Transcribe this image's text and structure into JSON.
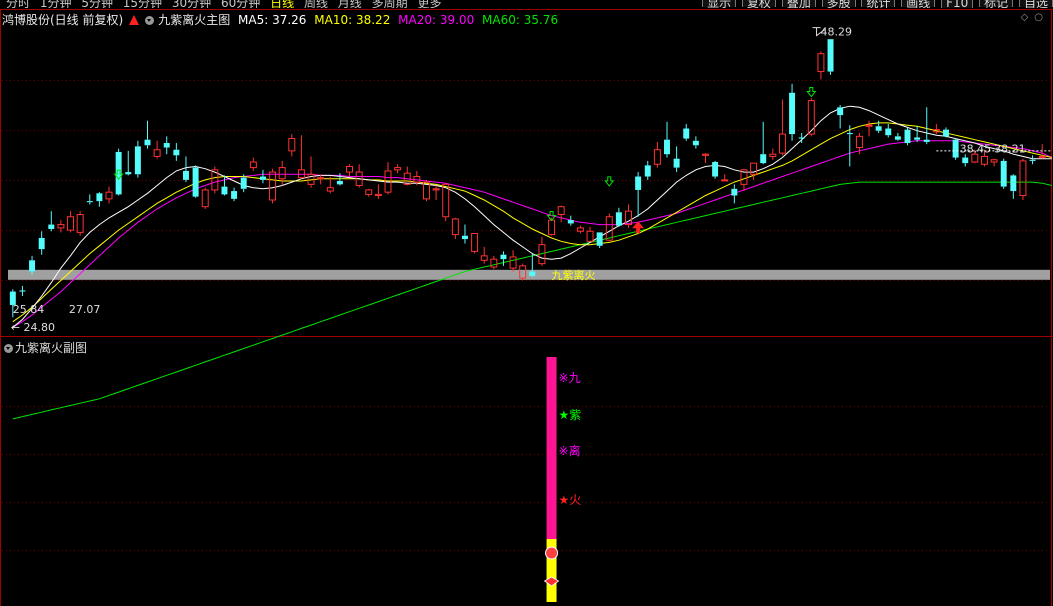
{
  "toolbar": {
    "periods": [
      "分时",
      "1分钟",
      "5分钟",
      "15分钟",
      "30分钟",
      "60分钟",
      "日线",
      "周线",
      "月线",
      "多周期",
      "更多"
    ],
    "active_period": "日线",
    "tools": [
      "显示",
      "复权",
      "叠加",
      "多股",
      "统计",
      "画线",
      "F10",
      "标记",
      "自选"
    ]
  },
  "main_legend": {
    "stock": "鸿博股份(日线 前复权)",
    "indicator": "九紫离火主图",
    "ma5": "MA5: 37.26",
    "ma10": "MA10: 38.22",
    "ma20": "MA20: 39.00",
    "ma60": "MA60: 35.76"
  },
  "sub_legend": {
    "name": "九紫离火副图"
  },
  "colors": {
    "up": "#ff3232",
    "down": "#54fcfc",
    "ma5": "#ffffff",
    "ma10": "#ffff00",
    "ma20": "#ff00ff",
    "ma60": "#00e600",
    "band": "#a0a0a0",
    "sub_bar": "#ff1493",
    "sub_bar_lower": "#ffff00"
  },
  "chart_data": [
    {
      "type": "candlestick",
      "title": "鸿博股份(日线 前复权)",
      "ylim": [
        23.2,
        50.6
      ],
      "candles": [
        [
          27.0,
          25.8,
          27.2,
          24.7
        ],
        [
          27.1,
          27.0,
          27.5,
          26.6
        ],
        [
          29.8,
          28.8,
          30.2,
          28.5
        ],
        [
          31.8,
          30.8,
          32.4,
          30.3
        ],
        [
          33.0,
          32.6,
          34.2,
          32.4
        ],
        [
          32.7,
          33.0,
          33.4,
          32.3
        ],
        [
          32.5,
          33.7,
          34.2,
          32.3
        ],
        [
          32.3,
          33.9,
          34.2,
          32.0
        ],
        [
          35.1,
          35.0,
          35.7,
          34.8
        ],
        [
          35.8,
          35.1,
          35.9,
          34.6
        ],
        [
          35.3,
          35.9,
          36.4,
          34.9
        ],
        [
          39.5,
          35.7,
          39.8,
          35.6
        ],
        [
          37.7,
          37.5,
          39.6,
          37.4
        ],
        [
          40.0,
          37.5,
          40.5,
          37.2
        ],
        [
          40.6,
          40.1,
          42.3,
          39.8
        ],
        [
          39.1,
          39.7,
          40.5,
          38.9
        ],
        [
          40.3,
          39.9,
          40.9,
          39.3
        ],
        [
          39.7,
          39.2,
          40.3,
          38.7
        ],
        [
          37.8,
          37.0,
          39.1,
          36.8
        ],
        [
          38.1,
          35.5,
          38.3,
          35.4
        ],
        [
          34.6,
          36.1,
          36.3,
          34.4
        ],
        [
          36.1,
          37.9,
          38.2,
          35.8
        ],
        [
          36.4,
          35.7,
          37.4,
          35.6
        ],
        [
          36.0,
          35.3,
          36.3,
          35.1
        ],
        [
          37.2,
          36.2,
          37.5,
          35.9
        ],
        [
          38.1,
          38.6,
          39.0,
          37.8
        ],
        [
          37.3,
          37.0,
          37.9,
          36.7
        ],
        [
          35.2,
          37.7,
          38.0,
          34.9
        ],
        [
          37.1,
          38.1,
          38.7,
          36.5
        ],
        [
          39.6,
          40.7,
          41.1,
          39.1
        ],
        [
          37.2,
          37.9,
          41.0,
          37.1
        ],
        [
          36.6,
          37.5,
          39.1,
          36.3
        ],
        [
          37.1,
          37.2,
          37.5,
          36.6
        ],
        [
          36.0,
          36.3,
          37.3,
          35.8
        ],
        [
          36.9,
          36.6,
          37.6,
          36.5
        ],
        [
          37.7,
          38.2,
          38.4,
          37.3
        ],
        [
          36.5,
          37.7,
          38.4,
          36.3
        ],
        [
          35.7,
          36.1,
          36.2,
          35.5
        ],
        [
          35.6,
          35.7,
          36.6,
          35.3
        ],
        [
          35.9,
          37.8,
          38.6,
          35.7
        ],
        [
          37.9,
          38.1,
          38.4,
          37.6
        ],
        [
          36.6,
          37.6,
          38.2,
          36.5
        ],
        [
          36.8,
          37.3,
          37.8,
          36.5
        ],
        [
          35.3,
          36.8,
          37.0,
          35.1
        ],
        [
          36.1,
          36.2,
          36.5,
          35.2
        ],
        [
          33.7,
          36.6,
          36.7,
          33.3
        ],
        [
          32.1,
          33.5,
          33.6,
          31.7
        ],
        [
          32.0,
          31.7,
          33.0,
          31.3
        ],
        [
          30.6,
          32.2,
          32.2,
          30.4
        ],
        [
          29.8,
          30.2,
          31.0,
          29.5
        ],
        [
          29.2,
          29.9,
          30.2,
          29.0
        ],
        [
          30.3,
          29.9,
          30.6,
          29.3
        ],
        [
          29.1,
          30.1,
          30.7,
          28.8
        ],
        [
          28.2,
          29.3,
          29.5,
          28.0
        ],
        [
          28.8,
          28.4,
          30.4,
          28.3
        ],
        [
          29.5,
          31.2,
          31.9,
          29.3
        ],
        [
          32.1,
          33.4,
          33.6,
          32.0
        ],
        [
          33.9,
          34.6,
          34.7,
          33.2
        ],
        [
          33.4,
          33.1,
          33.8,
          32.9
        ],
        [
          32.4,
          32.7,
          32.9,
          32.2
        ],
        [
          31.5,
          32.4,
          32.8,
          31.5
        ],
        [
          32.3,
          31.1,
          32.3,
          30.9
        ],
        [
          31.6,
          33.7,
          34.0,
          31.5
        ],
        [
          34.1,
          32.9,
          34.5,
          32.8
        ],
        [
          33.0,
          34.2,
          34.8,
          32.7
        ],
        [
          37.3,
          36.1,
          37.7,
          33.7
        ],
        [
          38.3,
          37.3,
          38.7,
          37.0
        ],
        [
          38.4,
          39.7,
          40.4,
          38.1
        ],
        [
          40.6,
          39.3,
          42.2,
          39.0
        ],
        [
          38.9,
          38.1,
          40.0,
          37.7
        ],
        [
          41.6,
          40.7,
          42.0,
          40.5
        ],
        [
          40.5,
          40.1,
          40.9,
          39.8
        ],
        [
          39.2,
          39.3,
          39.4,
          38.5
        ],
        [
          38.6,
          37.3,
          38.7,
          37.1
        ],
        [
          37.0,
          37.0,
          37.5,
          37.0
        ],
        [
          36.2,
          35.6,
          36.6,
          34.9
        ],
        [
          36.6,
          37.9,
          38.0,
          36.0
        ],
        [
          37.5,
          38.5,
          38.5,
          37.0
        ],
        [
          39.3,
          38.5,
          42.2,
          38.4
        ],
        [
          39.1,
          39.3,
          39.8,
          38.8
        ],
        [
          39.4,
          41.1,
          44.2,
          39.2
        ],
        [
          44.8,
          41.1,
          45.6,
          40.5
        ],
        [
          40.8,
          40.7,
          41.2,
          40.3
        ],
        [
          41.1,
          44.1,
          44.3,
          40.9
        ],
        [
          46.7,
          48.3,
          48.5,
          46.0
        ],
        [
          49.6,
          46.7,
          49.6,
          46.4
        ],
        [
          43.5,
          42.8,
          43.7,
          41.6
        ],
        [
          41.2,
          41.1,
          41.9,
          38.2
        ],
        [
          39.9,
          40.9,
          41.2,
          39.3
        ],
        [
          41.8,
          41.9,
          42.3,
          40.9
        ],
        [
          41.8,
          41.4,
          42.3,
          41.2
        ],
        [
          41.6,
          41.0,
          42.0,
          40.8
        ],
        [
          40.9,
          40.6,
          41.2,
          40.5
        ],
        [
          41.5,
          40.3,
          41.7,
          40.1
        ],
        [
          40.8,
          40.6,
          41.8,
          40.4
        ],
        [
          40.6,
          40.4,
          43.5,
          40.2
        ],
        [
          41.3,
          41.5,
          42.0,
          41.1
        ],
        [
          41.5,
          40.9,
          41.7,
          40.8
        ],
        [
          40.6,
          39.0,
          40.7,
          38.8
        ],
        [
          39.0,
          38.5,
          39.3,
          38.2
        ],
        [
          38.6,
          39.3,
          39.7,
          38.5
        ],
        [
          38.4,
          39.1,
          39.7,
          38.2
        ],
        [
          38.6,
          38.8,
          38.9,
          38.2
        ],
        [
          38.7,
          36.4,
          38.9,
          36.2
        ],
        [
          37.4,
          36.0,
          37.5,
          35.3
        ],
        [
          35.6,
          38.7,
          38.9,
          35.2
        ],
        [
          38.8,
          38.7,
          39.2,
          38.4
        ],
        [
          39.1,
          39.1,
          40.2,
          38.9
        ]
      ],
      "series": [
        {
          "name": "MA5",
          "values": [
            23.8,
            24.5,
            25.5,
            26.6,
            27.8,
            29.1,
            30.2,
            31.4,
            32.3,
            33.0,
            33.6,
            34.1,
            34.6,
            35.2,
            35.8,
            36.5,
            37.2,
            37.8,
            38.1,
            38.2,
            38.0,
            37.7,
            37.3,
            36.9,
            36.5,
            36.3,
            36.2,
            36.3,
            36.5,
            36.8,
            37.1,
            37.3,
            37.4,
            37.4,
            37.3,
            37.2,
            37.1,
            37.0,
            36.9,
            36.8,
            36.8,
            36.7,
            36.7,
            36.6,
            36.5,
            36.3,
            35.9,
            35.3,
            34.6,
            33.8,
            33.0,
            32.3,
            31.6,
            31.0,
            30.4,
            30.0,
            29.9,
            30.0,
            30.4,
            30.9,
            31.4,
            31.9,
            32.4,
            32.9,
            33.3,
            33.8,
            34.4,
            35.2,
            36.0,
            36.8,
            37.4,
            37.9,
            38.2,
            38.3,
            38.2,
            37.9,
            37.7,
            37.7,
            38.0,
            38.4,
            39.0,
            39.8,
            40.6,
            41.4,
            42.3,
            43.0,
            43.4,
            43.6,
            43.5,
            43.2,
            42.8,
            42.4,
            42.0,
            41.7,
            41.4,
            41.2,
            41.0,
            40.9,
            40.7,
            40.5,
            40.3,
            40.0,
            39.8,
            39.6,
            39.3,
            39.1,
            38.9,
            38.9,
            38.9
          ]
        },
        {
          "name": "MA10",
          "values": [
            24.3,
            24.9,
            25.6,
            26.4,
            27.2,
            28.0,
            28.8,
            29.6,
            30.4,
            31.1,
            31.8,
            32.5,
            33.1,
            33.7,
            34.3,
            34.9,
            35.4,
            35.9,
            36.3,
            36.7,
            37.0,
            37.2,
            37.3,
            37.3,
            37.3,
            37.2,
            37.1,
            37.0,
            36.9,
            36.9,
            36.9,
            37.0,
            37.1,
            37.1,
            37.1,
            37.1,
            37.1,
            37.0,
            37.0,
            36.9,
            36.9,
            36.9,
            36.8,
            36.7,
            36.6,
            36.4,
            36.2,
            36.0,
            35.6,
            35.2,
            34.7,
            34.2,
            33.6,
            33.1,
            32.6,
            32.2,
            31.8,
            31.5,
            31.3,
            31.2,
            31.2,
            31.3,
            31.4,
            31.6,
            31.9,
            32.2,
            32.6,
            33.1,
            33.6,
            34.1,
            34.6,
            35.1,
            35.6,
            36.0,
            36.4,
            36.8,
            37.1,
            37.4,
            37.7,
            38.0,
            38.3,
            38.7,
            39.2,
            39.7,
            40.2,
            40.7,
            41.1,
            41.5,
            41.8,
            42.0,
            42.1,
            42.1,
            42.0,
            41.9,
            41.8,
            41.6,
            41.4,
            41.2,
            41.0,
            40.8,
            40.6,
            40.4,
            40.2,
            40.0,
            39.8,
            39.6,
            39.4,
            39.2,
            39.0
          ]
        },
        {
          "name": "MA20",
          "values": [
            23.8,
            24.3,
            24.9,
            25.6,
            26.3,
            27.0,
            27.8,
            28.6,
            29.4,
            30.2,
            31.0,
            31.8,
            32.5,
            33.2,
            33.8,
            34.4,
            34.9,
            35.4,
            35.8,
            36.2,
            36.5,
            36.8,
            37.0,
            37.2,
            37.3,
            37.4,
            37.5,
            37.5,
            37.5,
            37.5,
            37.5,
            37.5,
            37.4,
            37.4,
            37.4,
            37.3,
            37.3,
            37.3,
            37.3,
            37.2,
            37.2,
            37.1,
            37.0,
            36.9,
            36.8,
            36.7,
            36.5,
            36.3,
            36.1,
            35.9,
            35.6,
            35.3,
            35.0,
            34.7,
            34.4,
            34.1,
            33.8,
            33.6,
            33.4,
            33.2,
            33.1,
            33.0,
            33.0,
            33.0,
            33.1,
            33.2,
            33.4,
            33.6,
            33.8,
            34.0,
            34.3,
            34.6,
            34.9,
            35.2,
            35.5,
            35.8,
            36.1,
            36.4,
            36.7,
            37.0,
            37.3,
            37.6,
            37.9,
            38.2,
            38.5,
            38.8,
            39.1,
            39.4,
            39.6,
            39.8,
            40.0,
            40.2,
            40.3,
            40.4,
            40.5,
            40.5,
            40.5,
            40.5,
            40.5,
            40.4,
            40.3,
            40.2,
            40.1,
            40.0,
            39.9,
            39.8,
            39.6,
            39.4,
            39.0
          ]
        },
        {
          "name": "MA60",
          "values": [
            15.6,
            15.8,
            16.0,
            16.2,
            16.4,
            16.6,
            16.8,
            17.0,
            17.2,
            17.4,
            17.7,
            18.0,
            18.3,
            18.6,
            18.9,
            19.2,
            19.5,
            19.8,
            20.1,
            20.4,
            20.7,
            21.0,
            21.3,
            21.6,
            21.9,
            22.2,
            22.5,
            22.8,
            23.1,
            23.4,
            23.7,
            24.0,
            24.3,
            24.6,
            24.9,
            25.2,
            25.5,
            25.8,
            26.1,
            26.4,
            26.7,
            27.0,
            27.3,
            27.6,
            27.9,
            28.2,
            28.5,
            28.8,
            29.0,
            29.2,
            29.4,
            29.6,
            29.8,
            30.0,
            30.2,
            30.4,
            30.6,
            30.8,
            31.0,
            31.2,
            31.4,
            31.6,
            31.8,
            32.0,
            32.2,
            32.4,
            32.6,
            32.8,
            33.0,
            33.2,
            33.4,
            33.6,
            33.8,
            34.0,
            34.2,
            34.4,
            34.6,
            34.8,
            35.0,
            35.2,
            35.4,
            35.6,
            35.8,
            36.0,
            36.2,
            36.4,
            36.6,
            36.7,
            36.8,
            36.8,
            36.8,
            36.8,
            36.8,
            36.8,
            36.8,
            36.8,
            36.8,
            36.8,
            36.8,
            36.8,
            36.8,
            36.8,
            36.8,
            36.8,
            36.8,
            36.8,
            36.8,
            36.7,
            36.5
          ]
        }
      ],
      "band_level": 28.5,
      "annotations": [
        {
          "text": "27.07",
          "at_index": 5,
          "value": 25.8
        },
        {
          "text": "← 24.80",
          "at_index": 0,
          "value": 24.7
        },
        {
          "text": "25.84",
          "at_index": 0,
          "value": 25.8
        },
        {
          "text": "48.29",
          "at_index": 85,
          "value": 48.3
        },
        {
          "text": "38.45",
          "at_index": 98,
          "value": 39.2
        },
        {
          "text": "38.21",
          "at_index": 102,
          "value": 39.2
        },
        {
          "text": "九紫离火",
          "at_index": 56,
          "value": 28.5
        }
      ]
    },
    {
      "type": "bar",
      "title": "九紫离火副图",
      "markers": [
        {
          "text": "※九",
          "color": "#ff00ff"
        },
        {
          "text": "★紫",
          "color": "#00ff00"
        },
        {
          "text": "※离",
          "color": "#ff00ff"
        },
        {
          "text": "★火",
          "color": "#ff2020"
        }
      ]
    }
  ]
}
